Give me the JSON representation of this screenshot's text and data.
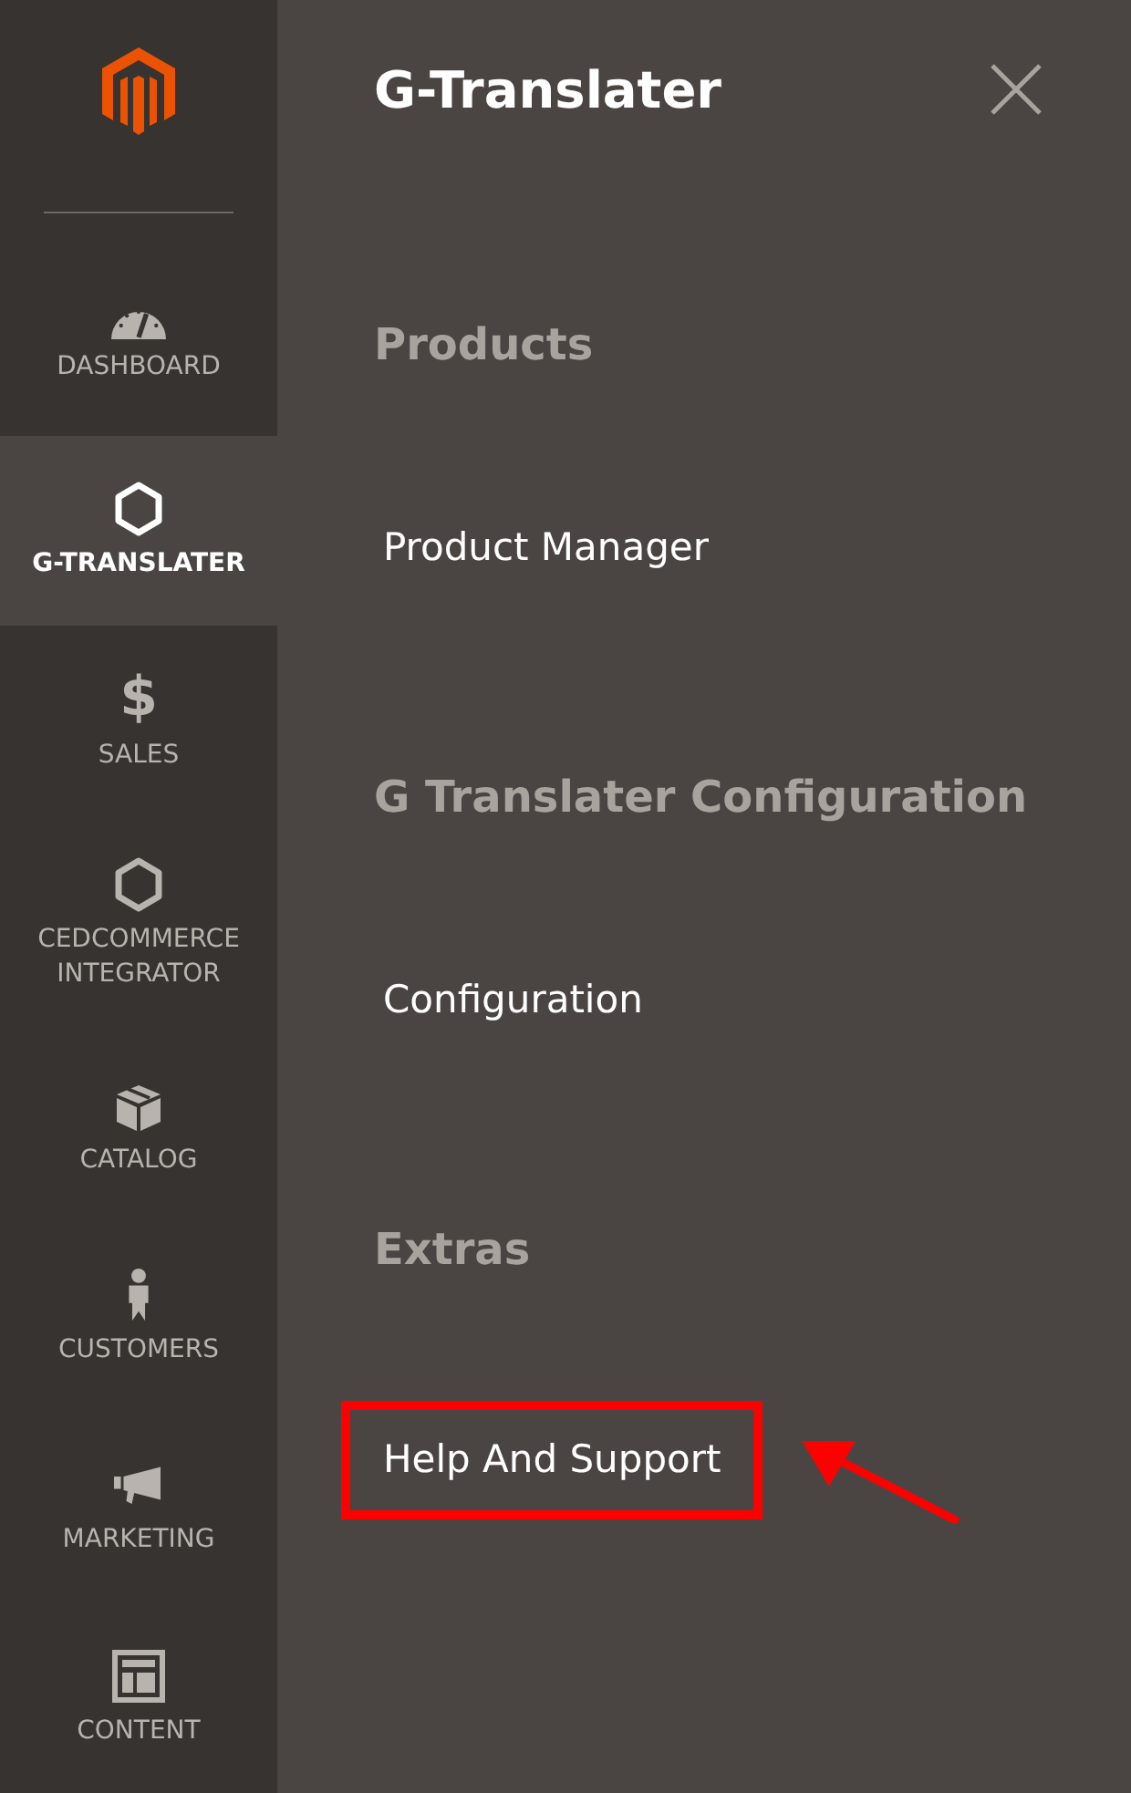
{
  "sidebar": {
    "items": [
      {
        "label": "DASHBOARD",
        "kind": "gauge",
        "selected": false
      },
      {
        "label": "G-TRANSLATER",
        "kind": "hexagon",
        "selected": true
      },
      {
        "label": "SALES",
        "glyph": "$",
        "selected": false
      },
      {
        "label": "CEDCOMMERCE INTEGRATOR",
        "kind": "hexagon",
        "selected": false
      },
      {
        "label": "CATALOG",
        "kind": "box",
        "selected": false
      },
      {
        "label": "CUSTOMERS",
        "kind": "person",
        "selected": false
      },
      {
        "label": "MARKETING",
        "kind": "megaphone",
        "selected": false
      },
      {
        "label": "CONTENT",
        "kind": "layout",
        "selected": false
      }
    ]
  },
  "panel": {
    "title": "G-Translater",
    "sections": [
      {
        "heading": "Products",
        "items": [
          {
            "label": "Product Manager",
            "highlighted": false
          }
        ]
      },
      {
        "heading": "G Translater Configuration",
        "items": [
          {
            "label": "Configuration",
            "highlighted": false
          }
        ]
      },
      {
        "heading": "Extras",
        "items": [
          {
            "label": "Help And Support",
            "highlighted": true
          }
        ]
      }
    ]
  }
}
